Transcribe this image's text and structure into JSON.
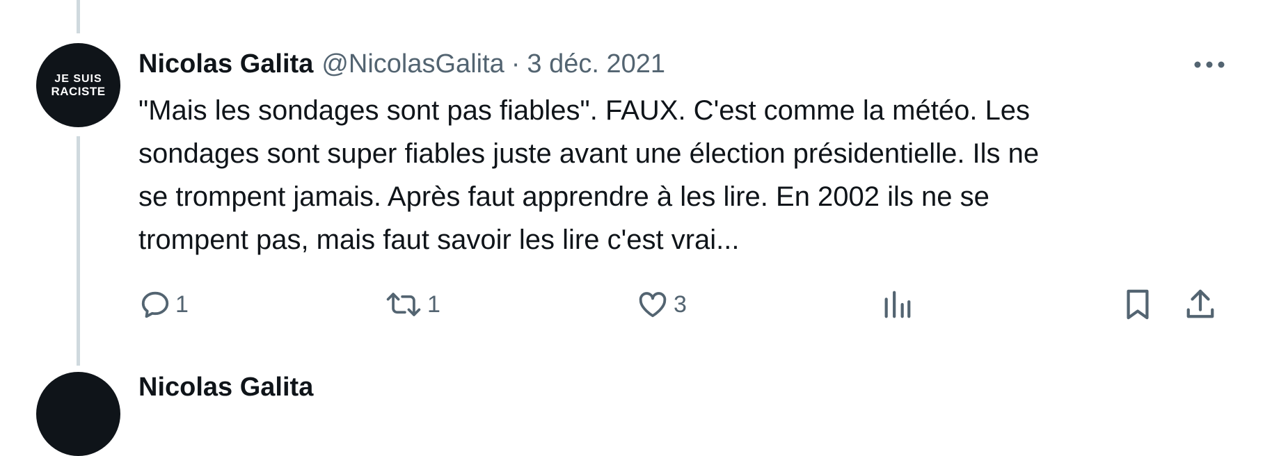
{
  "tweet": {
    "avatar_text_line1": "JE SUIS",
    "avatar_text_line2": "RACISTE",
    "author_name": "Nicolas Galita",
    "author_handle": "@NicolasGalita",
    "separator": "·",
    "date": "3 déc. 2021",
    "more_icon": "more-horizontal-icon",
    "text_lines": [
      "\"Mais les sondages sont pas fiables\". FAUX. C'est comme la météo. Les",
      "sondages sont super fiables juste avant une élection présidentielle. Ils ne",
      "se trompent jamais. Après faut apprendre à les lire. En 2002 ils ne se",
      "trompent pas, mais faut savoir les lire c'est vrai..."
    ],
    "actions": {
      "reply_count": "1",
      "retweet_count": "1",
      "like_count": "3",
      "icons": [
        "reply-icon",
        "retweet-icon",
        "like-icon",
        "views-icon",
        "bookmark-icon",
        "share-icon"
      ]
    }
  },
  "next_tweet": {
    "author_name": "Nicolas Galita"
  },
  "colors": {
    "text_primary": "#0f1419",
    "text_secondary": "#536471",
    "thread_line": "#cfd9de",
    "background": "#ffffff"
  }
}
